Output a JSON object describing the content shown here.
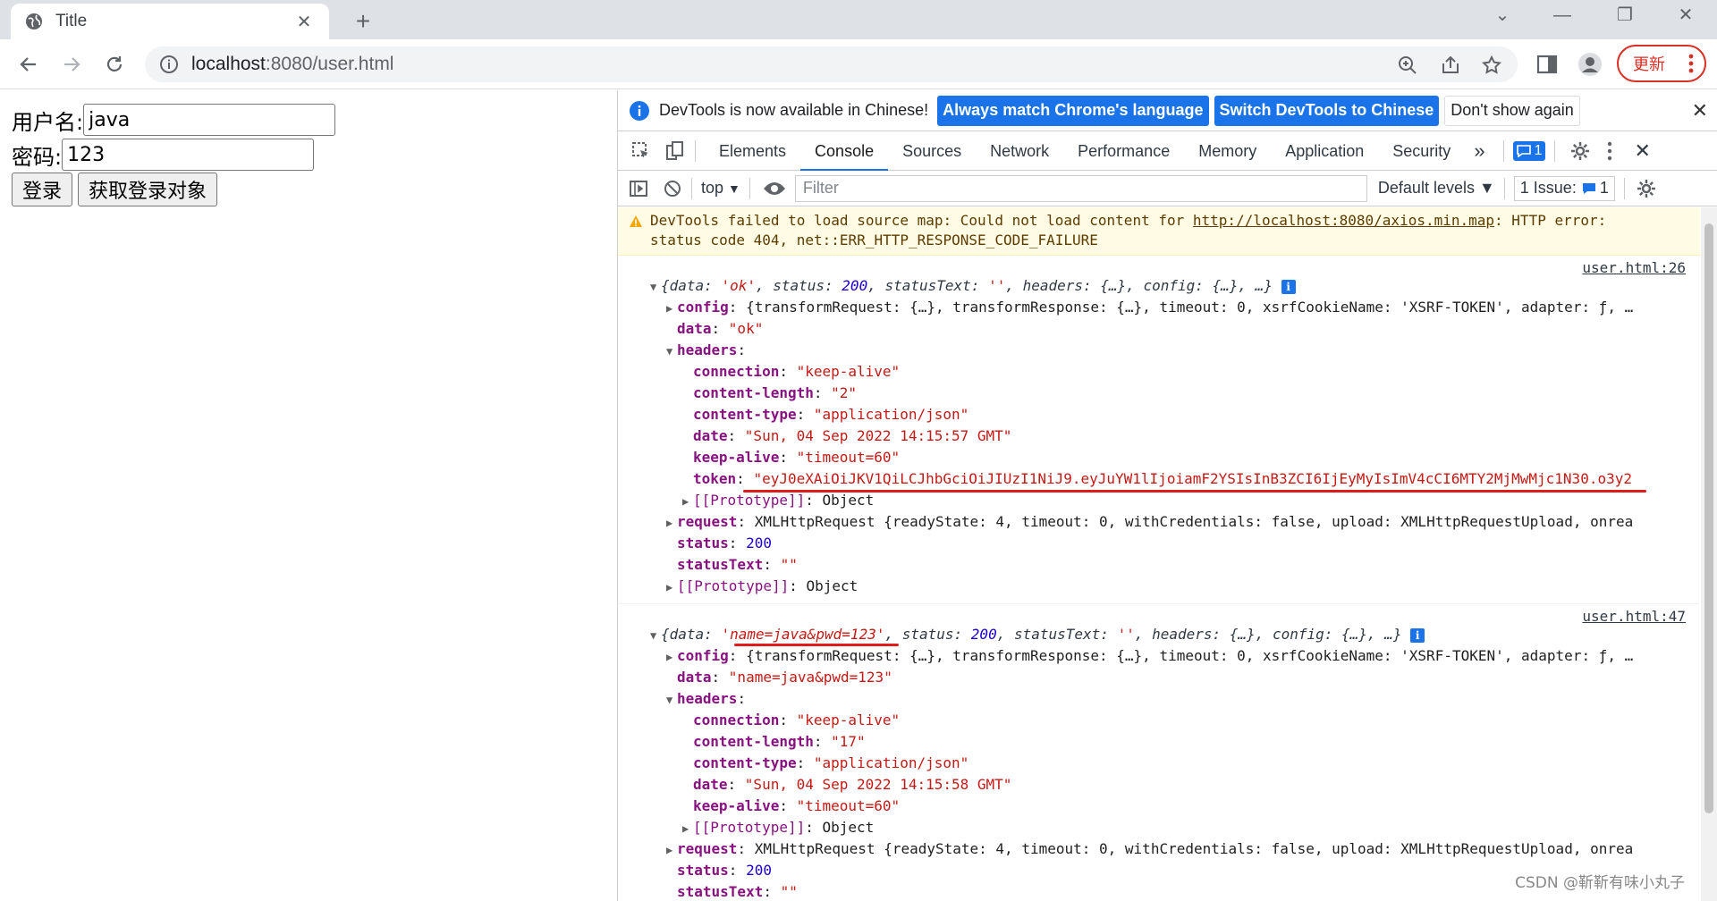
{
  "browser": {
    "tab_title": "Title",
    "url_host": "localhost",
    "url_rest": ":8080/user.html",
    "update_label": "更新"
  },
  "page": {
    "username_label": "用户名:",
    "username_value": "java",
    "password_label": "密码:",
    "password_value": "123",
    "login_button": "登录",
    "get_login_button": "获取登录对象"
  },
  "devtools": {
    "infobar_message": "DevTools is now available in Chinese!",
    "btn_match": "Always match Chrome's language",
    "btn_switch": "Switch DevTools to Chinese",
    "btn_dont_show": "Don't show again",
    "tabs": [
      "Elements",
      "Console",
      "Sources",
      "Network",
      "Performance",
      "Memory",
      "Application",
      "Security"
    ],
    "active_tab": "Console",
    "more_tabs": "»",
    "msg_count": "1",
    "context": "top",
    "filter_placeholder": "Filter",
    "levels": "Default levels ▼",
    "issues_label": "1 Issue:",
    "issues_count": "1"
  },
  "console": {
    "warning_line1_prefix": "DevTools failed to load source map: Could not load content for ",
    "warning_link": "http://localhost:8080/axios.min.map",
    "warning_line1_suffix": ": HTTP error:",
    "warning_line2": "status code 404, net::ERR_HTTP_RESPONSE_CODE_FAILURE",
    "entry1": {
      "source": "user.html:26",
      "summary_data": "'ok'",
      "summary_status": "200",
      "config_line": "{transformRequest: {…}, transformResponse: {…}, timeout: 0, xsrfCookieName: 'XSRF-TOKEN', adapter: ƒ, …",
      "data": "\"ok\"",
      "connection": "\"keep-alive\"",
      "content_length": "\"2\"",
      "content_type": "\"application/json\"",
      "date": "\"Sun, 04 Sep 2022 14:15:57 GMT\"",
      "keep_alive": "\"timeout=60\"",
      "token": "\"eyJ0eXAiOiJKV1QiLCJhbGciOiJIUzI1NiJ9.eyJuYW1lIjoiamF2YSIsInB3ZCI6IjEyMyIsImV4cCI6MTY2MjMwMjc1N30.o3y2",
      "request_line": "XMLHttpRequest {readyState: 4, timeout: 0, withCredentials: false, upload: XMLHttpRequestUpload, onrea",
      "status": "200",
      "status_text": "\"\""
    },
    "entry2": {
      "source": "user.html:47",
      "summary_data": "'name=java&pwd=123'",
      "summary_status": "200",
      "config_line": "{transformRequest: {…}, transformResponse: {…}, timeout: 0, xsrfCookieName: 'XSRF-TOKEN', adapter: ƒ, …",
      "data": "\"name=java&pwd=123\"",
      "connection": "\"keep-alive\"",
      "content_length": "\"17\"",
      "content_type": "\"application/json\"",
      "date": "\"Sun, 04 Sep 2022 14:15:58 GMT\"",
      "keep_alive": "\"timeout=60\"",
      "request_line": "XMLHttpRequest {readyState: 4, timeout: 0, withCredentials: false, upload: XMLHttpRequestUpload, onrea",
      "status": "200",
      "status_text": "\"\""
    }
  },
  "watermark": "CSDN @靳靳有味小丸子",
  "colors": {
    "accent": "#1a73e8",
    "annotation": "#e01b1b",
    "update": "#d93025"
  }
}
